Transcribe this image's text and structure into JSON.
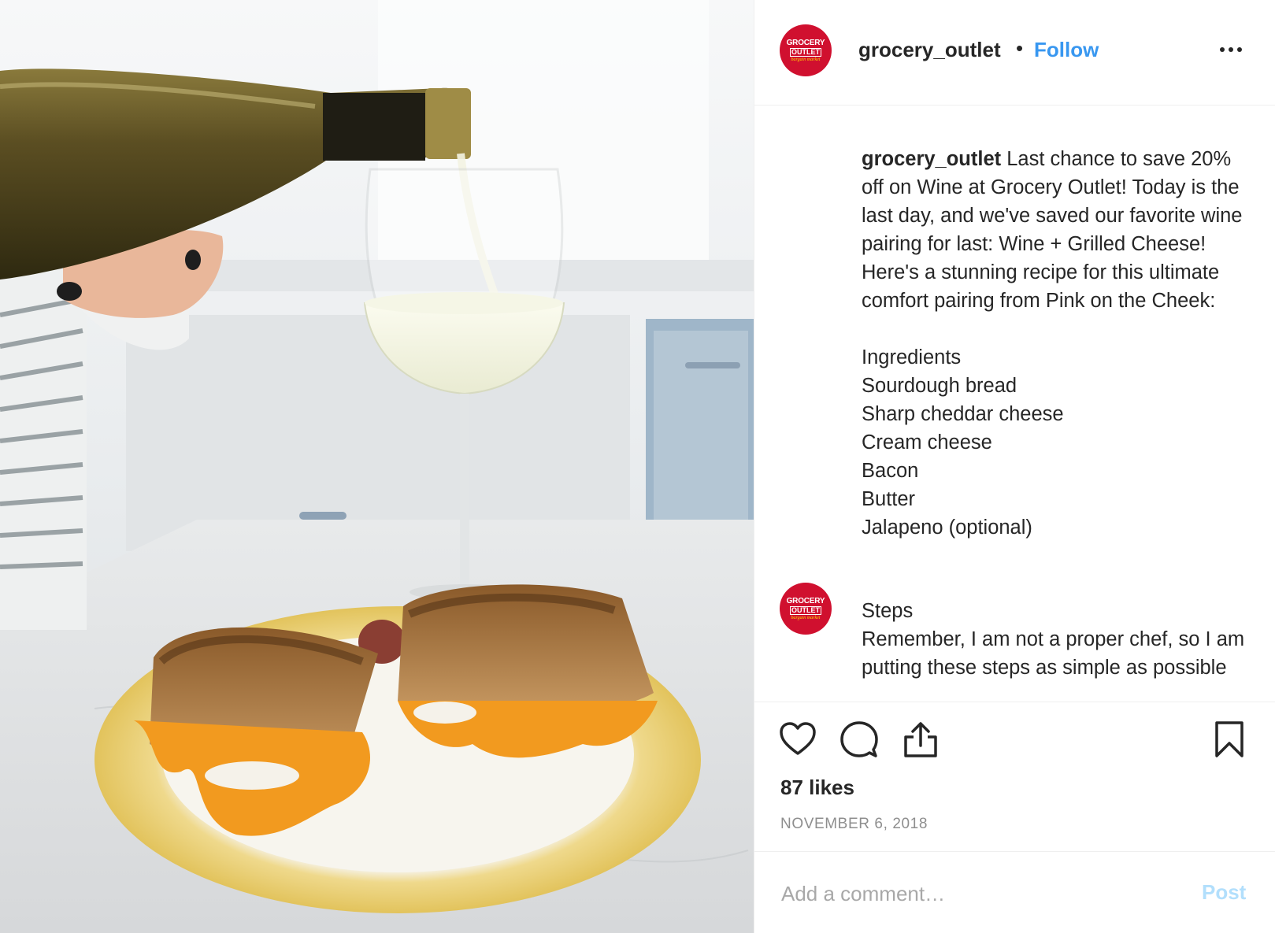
{
  "post": {
    "account": {
      "username": "grocery_outlet",
      "separator": "•",
      "follow_label": "Follow",
      "avatar_logo": {
        "line1": "GROCERY",
        "line2": "OUTLET",
        "line3": "bargain market"
      }
    },
    "caption": {
      "username": "grocery_outlet",
      "text": " Last chance to save 20% off on Wine at Grocery Outlet! Today is the last day, and we've saved our favorite wine pairing for last: Wine + Grilled Cheese! Here's a stunning recipe for this ultimate comfort pairing from Pink on the Cheek:\n\nIngredients\nSourdough bread\nSharp cheddar cheese\nCream cheese\nBacon\nButter\nJalapeno (optional)",
      "steps_text": "Steps\nRemember, I am not a proper chef, so I am putting these steps as simple as possible"
    },
    "likes": "87 likes",
    "date": "NOVEMBER 6, 2018",
    "comment": {
      "placeholder": "Add a comment…",
      "post_label": "Post"
    },
    "icons": {
      "more": "more-options-icon",
      "like": "heart-icon",
      "comment": "comment-bubble-icon",
      "share": "share-icon",
      "save": "bookmark-icon"
    },
    "colors": {
      "brand_red": "#d0102f",
      "link_blue": "#3897f0",
      "post_disabled": "#b2dffc",
      "muted_text": "#8e8e8e"
    }
  }
}
